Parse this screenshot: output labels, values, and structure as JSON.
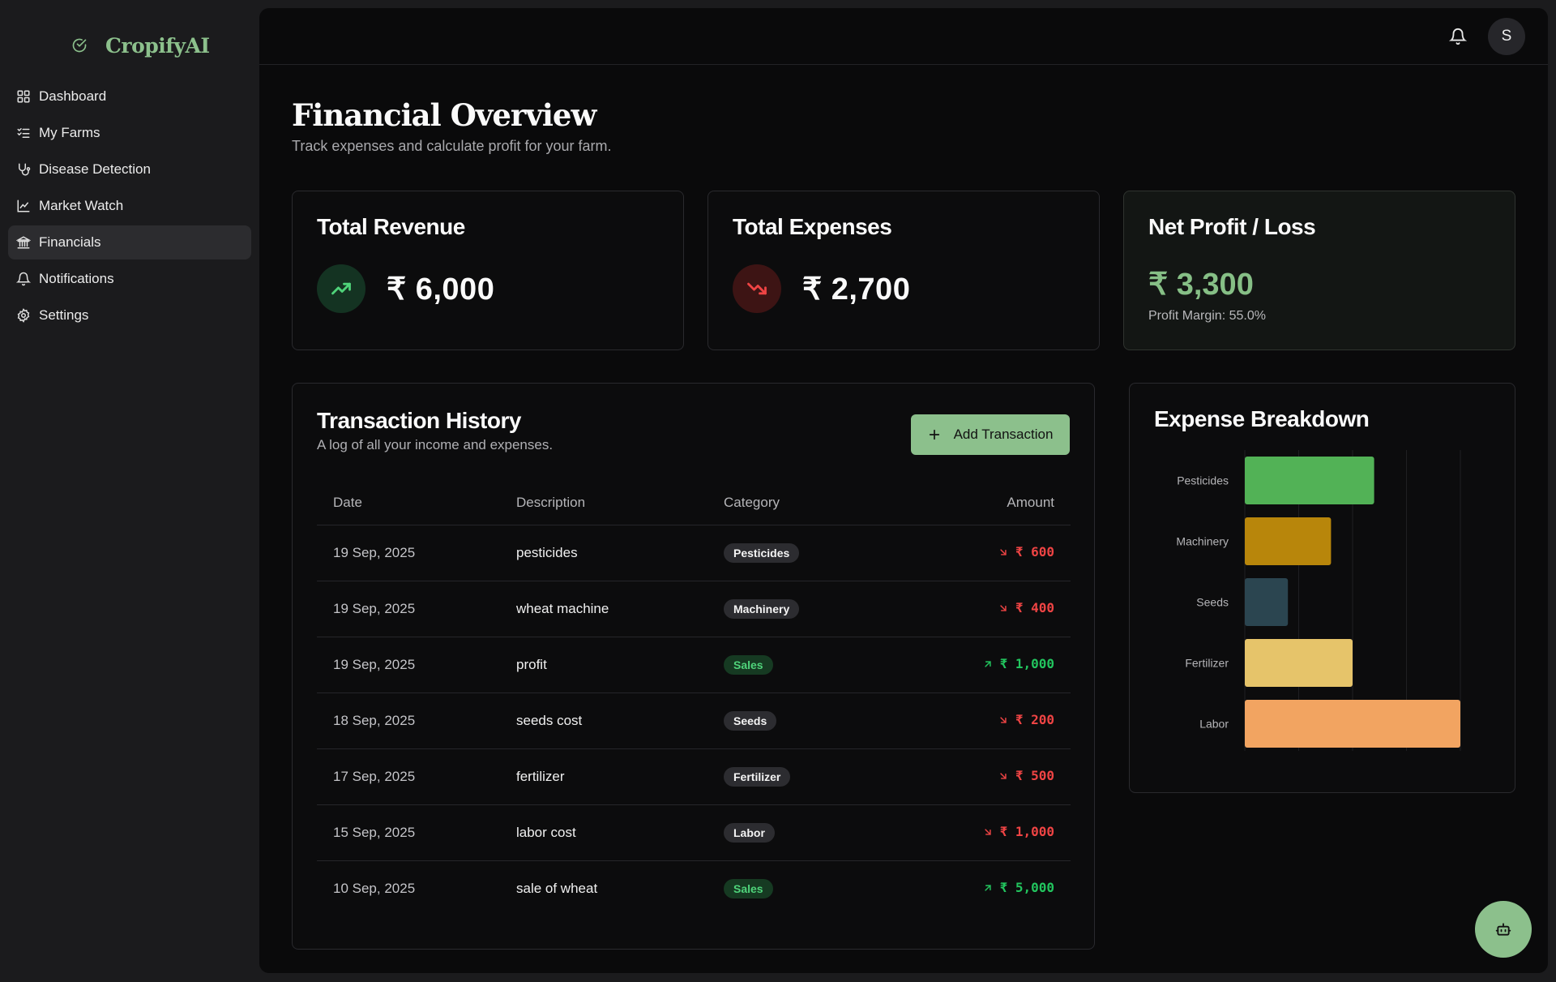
{
  "brand": {
    "name": "CropifyAI"
  },
  "sidebar": {
    "items": [
      {
        "label": "Dashboard",
        "icon": "grid-icon"
      },
      {
        "label": "My Farms",
        "icon": "list-checks-icon"
      },
      {
        "label": "Disease Detection",
        "icon": "stethoscope-icon"
      },
      {
        "label": "Market Watch",
        "icon": "line-chart-icon"
      },
      {
        "label": "Financials",
        "icon": "bank-icon",
        "active": true
      },
      {
        "label": "Notifications",
        "icon": "bell-icon"
      },
      {
        "label": "Settings",
        "icon": "gear-icon"
      }
    ]
  },
  "header": {
    "avatar_initial": "S"
  },
  "page": {
    "title": "Financial Overview",
    "subtitle": "Track expenses and calculate profit for your farm."
  },
  "stats": {
    "revenue": {
      "title": "Total Revenue",
      "value": "₹ 6,000"
    },
    "expenses": {
      "title": "Total Expenses",
      "value": "₹ 2,700"
    },
    "profit": {
      "title": "Net Profit / Loss",
      "value": "₹ 3,300",
      "margin": "Profit Margin: 55.0%"
    }
  },
  "transactions": {
    "title": "Transaction History",
    "subtitle": "A log of all your income and expenses.",
    "add_label": "Add Transaction",
    "columns": {
      "date": "Date",
      "description": "Description",
      "category": "Category",
      "amount": "Amount"
    },
    "rows": [
      {
        "date": "19 Sep, 2025",
        "description": "pesticides",
        "category": "Pesticides",
        "amount": "₹ 600",
        "type": "expense"
      },
      {
        "date": "19 Sep, 2025",
        "description": "wheat machine",
        "category": "Machinery",
        "amount": "₹ 400",
        "type": "expense"
      },
      {
        "date": "19 Sep, 2025",
        "description": "profit",
        "category": "Sales",
        "amount": "₹ 1,000",
        "type": "income"
      },
      {
        "date": "18 Sep, 2025",
        "description": "seeds cost",
        "category": "Seeds",
        "amount": "₹ 200",
        "type": "expense"
      },
      {
        "date": "17 Sep, 2025",
        "description": "fertilizer",
        "category": "Fertilizer",
        "amount": "₹ 500",
        "type": "expense"
      },
      {
        "date": "15 Sep, 2025",
        "description": "labor cost",
        "category": "Labor",
        "amount": "₹ 1,000",
        "type": "expense"
      },
      {
        "date": "10 Sep, 2025",
        "description": "sale of wheat",
        "category": "Sales",
        "amount": "₹ 5,000",
        "type": "income"
      }
    ]
  },
  "chart_data": {
    "type": "bar",
    "orientation": "horizontal",
    "title": "Expense Breakdown",
    "categories": [
      "Pesticides",
      "Machinery",
      "Seeds",
      "Fertilizer",
      "Labor"
    ],
    "values": [
      600,
      400,
      200,
      500,
      1000
    ],
    "colors": [
      "#52b256",
      "#b8860b",
      "#2b4550",
      "#e6c46a",
      "#f2a461"
    ],
    "xlim": [
      0,
      1000
    ],
    "grid": "vertical"
  },
  "colors": {
    "accent": "#8cc08c",
    "income": "#22c55e",
    "expense": "#ef4444"
  }
}
